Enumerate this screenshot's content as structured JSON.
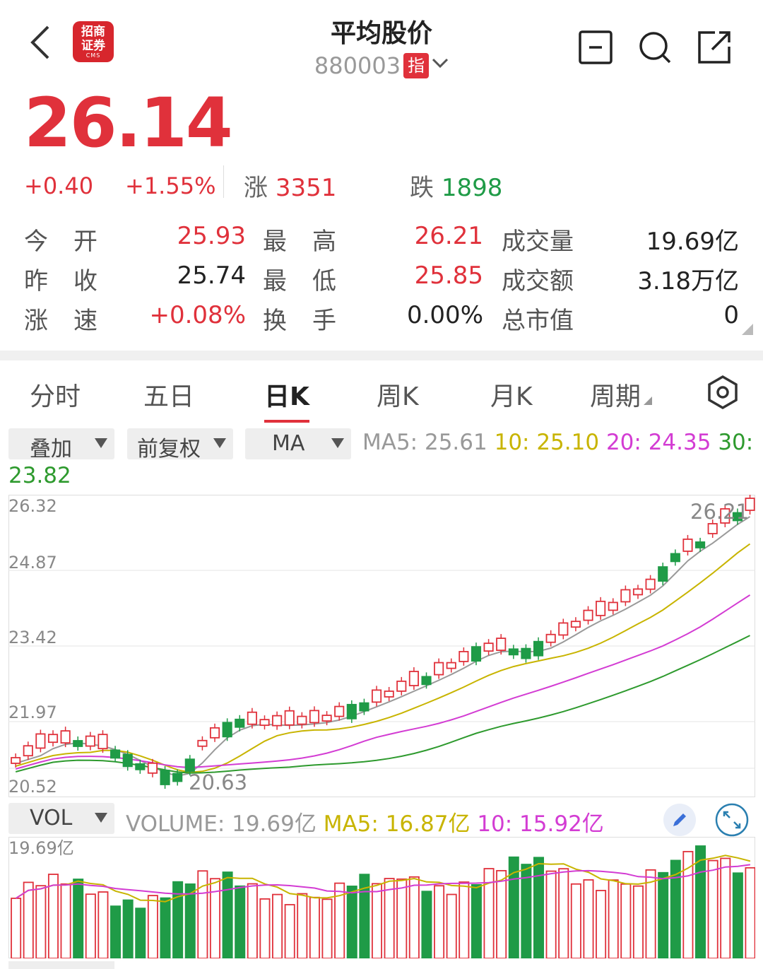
{
  "header": {
    "title": "平均股价",
    "code": "880003",
    "index_badge": "指",
    "logo_line1": "招商",
    "logo_line2": "证券",
    "logo_sub": "CMS"
  },
  "quote": {
    "price": "26.14",
    "change": "+0.40",
    "change_pct": "+1.55%",
    "up_label": "涨",
    "up_count": "3351",
    "down_label": "跌",
    "down_count": "1898"
  },
  "stats": {
    "open_label": "今开",
    "open": "25.93",
    "high_label": "最高",
    "high": "26.21",
    "vol_label": "成交量",
    "vol": "19.69亿",
    "prev_label": "昨收",
    "prev": "25.74",
    "low_label": "最低",
    "low": "25.85",
    "amount_label": "成交额",
    "amount": "3.18万亿",
    "speed_label": "涨速",
    "speed": "+0.08%",
    "turnover_label": "换手",
    "turnover": "0.00%",
    "mcap_label": "总市值",
    "mcap": "0"
  },
  "tabs": [
    "分时",
    "五日",
    "日K",
    "周K",
    "月K",
    "周期"
  ],
  "active_tab": "日K",
  "toolbar": {
    "overlay": "叠加",
    "adjust": "前复权",
    "indicator": "MA",
    "ma5": "MA5: 25.61",
    "ma10": "10: 25.10",
    "ma20": "20: 24.35",
    "ma30_label": "30:",
    "ma30_value": "23.82"
  },
  "kline_axis": [
    "26.32",
    "24.87",
    "23.42",
    "21.97",
    "20.52"
  ],
  "kline_marks": {
    "high": "26.21",
    "low": "20.63"
  },
  "volume_bar": {
    "indicator": "VOL",
    "volume": "VOLUME: 19.69亿",
    "ma5": "MA5: 16.87亿",
    "ma10": "10: 15.92亿",
    "axis_top": "19.69亿"
  },
  "colors": {
    "up": "#e0313b",
    "down": "#1f9b47",
    "ma5": "#9a9a9a",
    "ma10": "#c8b400",
    "ma20": "#d33cd3",
    "ma30": "#2e9a2e"
  }
}
